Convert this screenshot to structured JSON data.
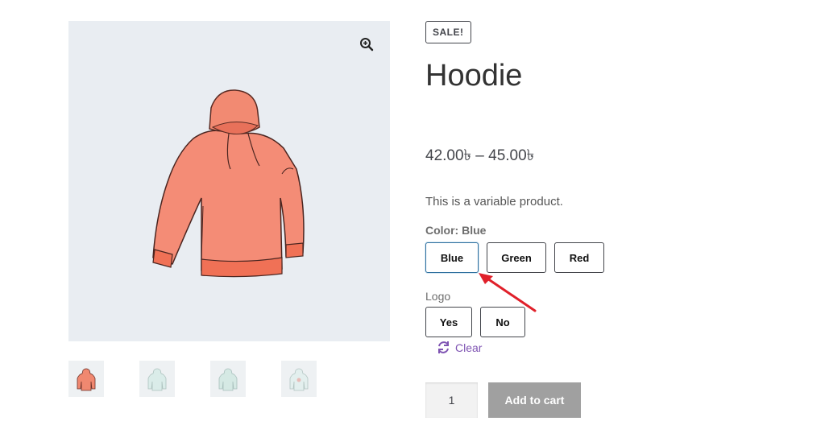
{
  "product": {
    "sale_badge": "SALE!",
    "title": "Hoodie",
    "price_range": "42.00৳ – 45.00৳",
    "description": "This is a variable product."
  },
  "gallery": {
    "zoom_icon": "zoom-in-icon",
    "thumbnails": [
      "hoodie-red",
      "hoodie-green",
      "hoodie-green-2",
      "hoodie-logo"
    ]
  },
  "attributes": {
    "color": {
      "label": "Color:",
      "selected": "Blue",
      "options": [
        "Blue",
        "Green",
        "Red"
      ]
    },
    "logo": {
      "label": "Logo",
      "options": [
        "Yes",
        "No"
      ]
    }
  },
  "actions": {
    "clear_label": "Clear",
    "clear_icon": "refresh-icon",
    "quantity": "1",
    "add_to_cart_label": "Add to cart"
  },
  "colors": {
    "accent_link": "#7f54b3",
    "selected_border": "#2e6f9e",
    "button_disabled": "#a0a0a0",
    "annotation_arrow": "#e0202a"
  }
}
